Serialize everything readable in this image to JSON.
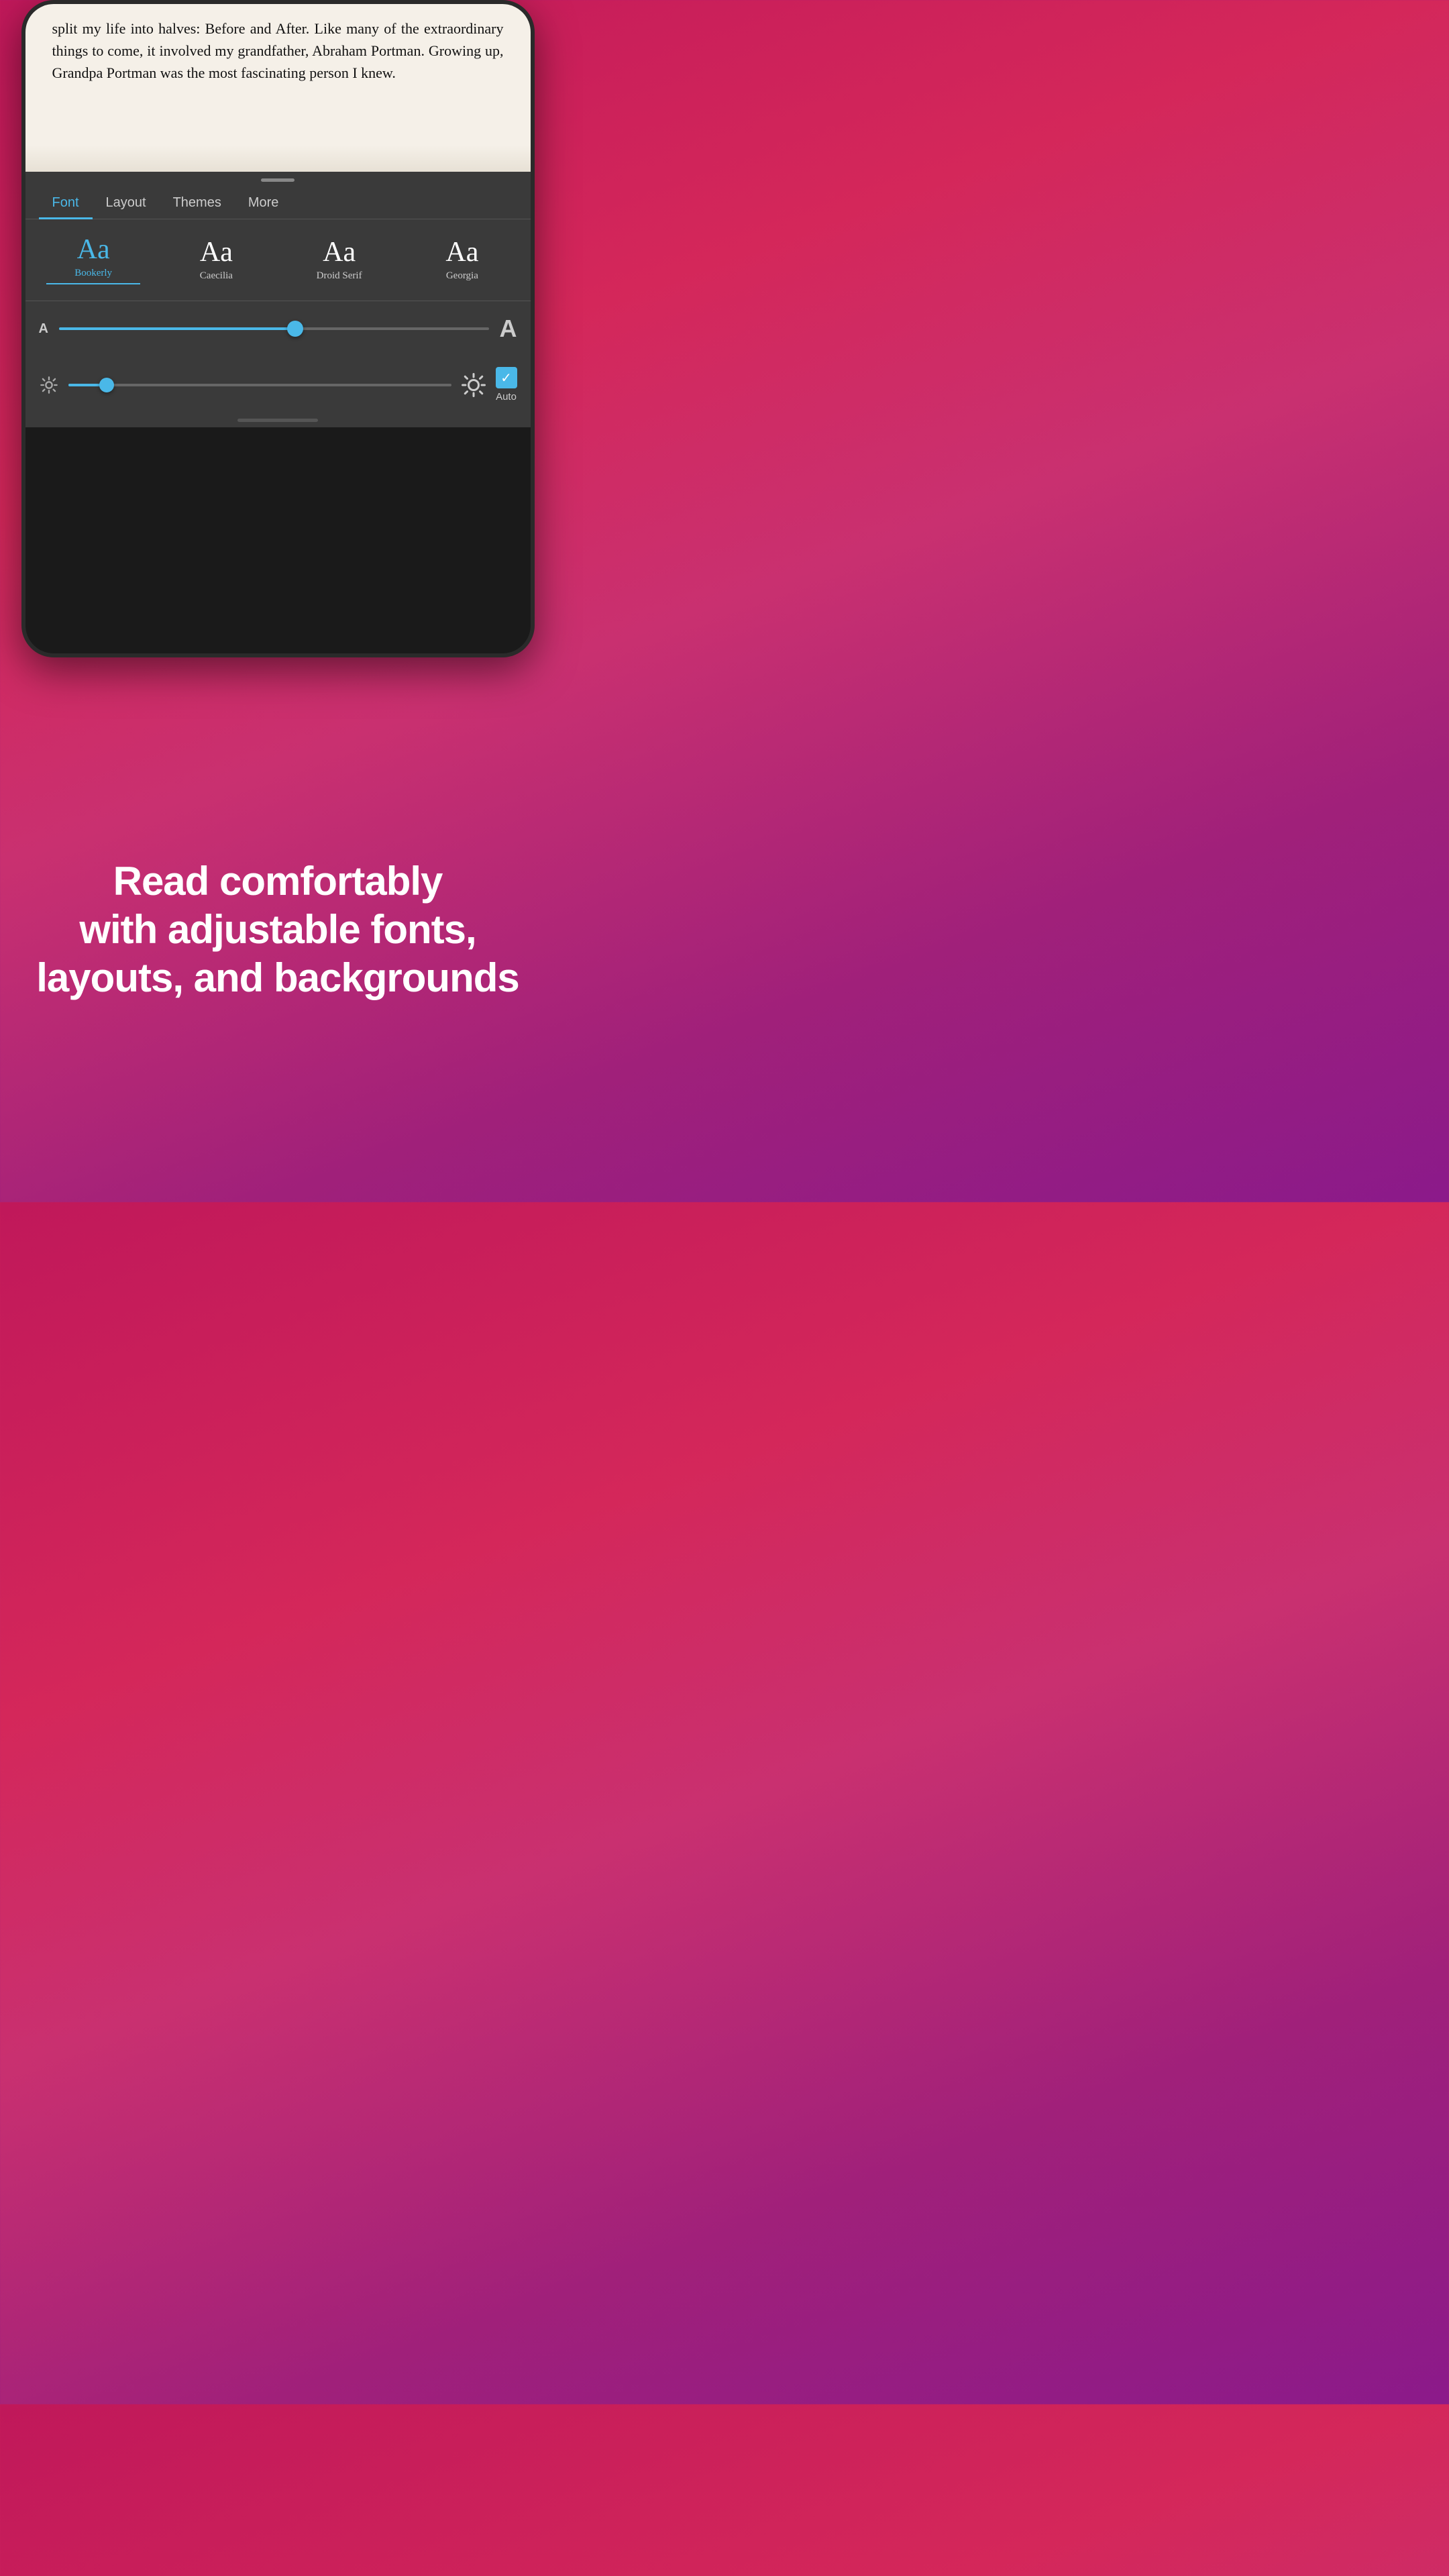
{
  "phone": {
    "book_text": "split my life into halves: Before and After. Like many of the extraordinary things to come, it involved my grandfather, Abraham Portman. Growing up, Grandpa Portman was the most fascinating person I knew."
  },
  "tabs": {
    "font_label": "Font",
    "layout_label": "Layout",
    "themes_label": "Themes",
    "more_label": "More",
    "active": "Font"
  },
  "fonts": [
    {
      "sample": "Aa",
      "name": "Bookerly",
      "selected": true
    },
    {
      "sample": "Aa",
      "name": "Caecilia",
      "selected": false
    },
    {
      "sample": "Aa",
      "name": "Droid Serif",
      "selected": false
    },
    {
      "sample": "Aa",
      "name": "Georgia",
      "selected": false
    }
  ],
  "font_size": {
    "small_label": "A",
    "large_label": "A",
    "slider_percent": 55
  },
  "brightness": {
    "slider_percent": 10,
    "auto_label": "Auto",
    "auto_checked": true
  },
  "marketing": {
    "line1": "Read comfortably",
    "line2": "with adjustable fonts,",
    "line3": "layouts, and backgrounds"
  }
}
